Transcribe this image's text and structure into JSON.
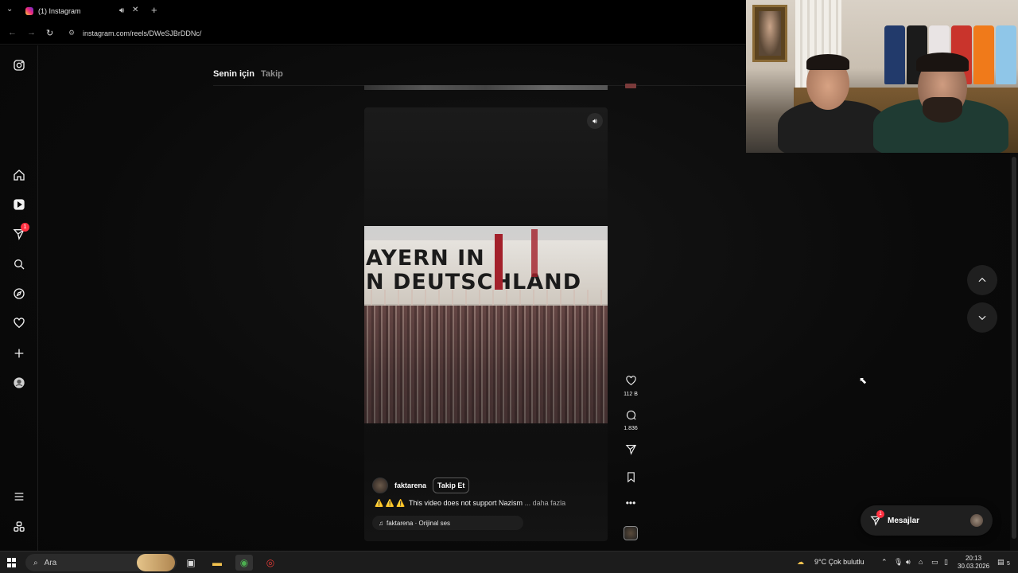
{
  "browser": {
    "tab_title": "(1) Instagram",
    "url": "instagram.com/reels/DWeSJBrDDNc/"
  },
  "feed_tabs": {
    "for_you": "Senin için",
    "following": "Takip"
  },
  "nav": {
    "notifications_badge": "1"
  },
  "reel": {
    "banner_text_line1": "AYERN IN",
    "banner_text_line2": "N DEUTSCHLAND",
    "author": "faktarena",
    "follow_label": "Takip Et",
    "caption_warning": "⚠️ ⚠️ ⚠️",
    "caption": "This video does not support Nazism",
    "caption_more": "... daha fazla",
    "audio": "faktarena · Orijinal ses",
    "likes": "112 B",
    "comments": "1.836"
  },
  "messages": {
    "label": "Mesajlar",
    "badge": "1"
  },
  "taskbar": {
    "search_placeholder": "Ara",
    "weather": "9°C  Çok bulutlu",
    "time": "20:13",
    "date": "30.03.2026",
    "notification_count": "5"
  },
  "colors": {
    "accent_badge": "#ff3040",
    "background": "#000000"
  },
  "icons": [
    "instagram-icon",
    "home-icon",
    "reels-icon",
    "send-icon",
    "search-icon",
    "explore-icon",
    "heart-icon",
    "create-icon",
    "profile-icon",
    "menu-icon",
    "threads-icon",
    "volume-icon",
    "comment-icon",
    "bookmark-icon",
    "more-icon",
    "chevron-up-icon",
    "chevron-down-icon",
    "windows-icon"
  ]
}
